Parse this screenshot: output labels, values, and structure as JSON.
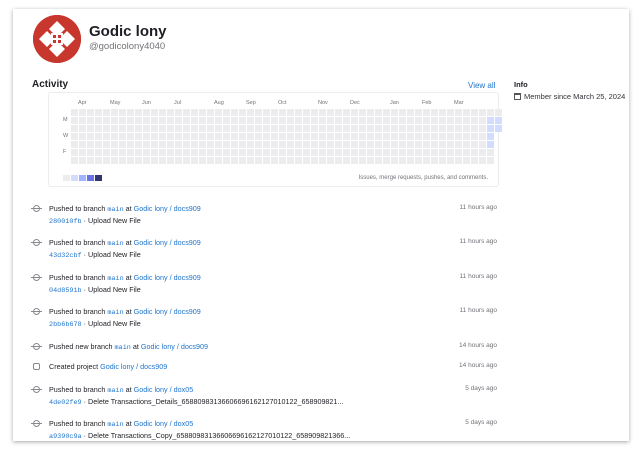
{
  "profile": {
    "name": "Godic lony",
    "handle": "@godicolony4040"
  },
  "activity": {
    "title": "Activity",
    "view_all": "View all",
    "months": [
      "Apr",
      "May",
      "Jun",
      "Jul",
      "Aug",
      "Sep",
      "Oct",
      "Nov",
      "Dec",
      "Jan",
      "Feb",
      "Mar"
    ],
    "days": [
      "M",
      "W",
      "F"
    ],
    "legend_text": "Issues, merge requests, pushes, and comments."
  },
  "info": {
    "title": "Info",
    "member_since": "Member since March 25, 2024"
  },
  "colors": {
    "accent": "#1f75cb",
    "avatar": "#c8372d",
    "empty_cell": "#ececef",
    "level1": "#d2dcff",
    "level2": "#a0b4ff",
    "level3": "#6973e8",
    "level4": "#303470"
  },
  "events": [
    {
      "icon": "push-icon",
      "action": "Pushed to branch",
      "branch": "main",
      "at": "at",
      "project": "Godic lony / docs909",
      "time": "11 hours ago",
      "commit": "280010fb",
      "sep": "·",
      "message": "Upload New File"
    },
    {
      "icon": "push-icon",
      "action": "Pushed to branch",
      "branch": "main",
      "at": "at",
      "project": "Godic lony / docs909",
      "time": "11 hours ago",
      "commit": "43d32cbf",
      "sep": "·",
      "message": "Upload New File"
    },
    {
      "icon": "push-icon",
      "action": "Pushed to branch",
      "branch": "main",
      "at": "at",
      "project": "Godic lony / docs909",
      "time": "11 hours ago",
      "commit": "04d8591b",
      "sep": "·",
      "message": "Upload New File"
    },
    {
      "icon": "push-icon",
      "action": "Pushed to branch",
      "branch": "main",
      "at": "at",
      "project": "Godic lony / docs909",
      "time": "11 hours ago",
      "commit": "2bb6b678",
      "sep": "·",
      "message": "Upload New File"
    },
    {
      "icon": "push-icon",
      "action": "Pushed new branch",
      "branch": "main",
      "at": "at",
      "project": "Godic lony / docs909",
      "time": "14 hours ago",
      "commit": "",
      "sep": "",
      "message": ""
    },
    {
      "icon": "project-icon",
      "action": "Created project",
      "branch": "",
      "at": "",
      "project": "Godic lony / docs909",
      "time": "14 hours ago",
      "commit": "",
      "sep": "",
      "message": ""
    },
    {
      "icon": "push-icon",
      "action": "Pushed to branch",
      "branch": "main",
      "at": "at",
      "project": "Godic lony / dox05",
      "time": "5 days ago",
      "commit": "4de02fe9",
      "sep": "·",
      "message": "Delete Transactions_Details_65880983136606696162127010122_658909821..."
    },
    {
      "icon": "push-icon",
      "action": "Pushed to branch",
      "branch": "main",
      "at": "at",
      "project": "Godic lony / dox05",
      "time": "5 days ago",
      "commit": "a9390c9a",
      "sep": "·",
      "message": "Delete Transactions_Copy_65880983136606696162127010122_658909821366..."
    }
  ]
}
